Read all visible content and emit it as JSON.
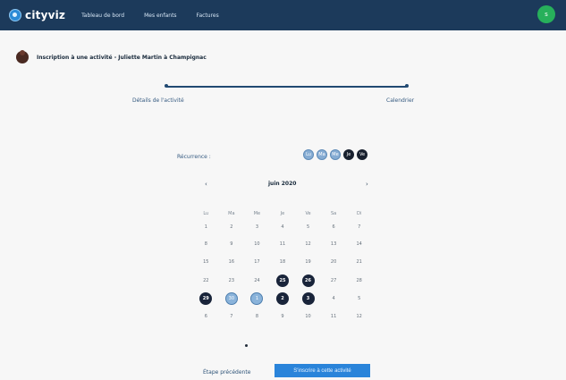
{
  "app": {
    "logo": "cityviz"
  },
  "nav": {
    "items": [
      "Tableau de bord",
      "Mes enfants",
      "Factures"
    ]
  },
  "header": {
    "title": "Inscription à une activité - Juliette Martin à Champignac",
    "avatar_text": "s"
  },
  "steps": {
    "step1": "Détails de l'activité",
    "step2": "Calendrier"
  },
  "recurrence": {
    "label": "Récurrence :",
    "chips": [
      {
        "label": "Lu",
        "style": "light"
      },
      {
        "label": "Ma",
        "style": "light"
      },
      {
        "label": "Me",
        "style": "light"
      },
      {
        "label": "Je",
        "style": "dark"
      },
      {
        "label": "Ve",
        "style": "dark"
      }
    ]
  },
  "calendar": {
    "prev": "‹",
    "next": "›",
    "month": "juin 2020",
    "weekdays": [
      "Lu",
      "Ma",
      "Me",
      "Je",
      "Ve",
      "Sa",
      "Di"
    ],
    "rows": [
      [
        {
          "t": "1"
        },
        {
          "t": "2"
        },
        {
          "t": "3"
        },
        {
          "t": "4"
        },
        {
          "t": "5"
        },
        {
          "t": "6"
        },
        {
          "t": "7"
        }
      ],
      [
        {
          "t": "8"
        },
        {
          "t": "9"
        },
        {
          "t": "10"
        },
        {
          "t": "11"
        },
        {
          "t": "12"
        },
        {
          "t": "13"
        },
        {
          "t": "14"
        }
      ],
      [
        {
          "t": "15"
        },
        {
          "t": "16"
        },
        {
          "t": "17"
        },
        {
          "t": "18"
        },
        {
          "t": "19"
        },
        {
          "t": "20"
        },
        {
          "t": "21"
        }
      ],
      [
        {
          "t": "22"
        },
        {
          "t": "23"
        },
        {
          "t": "24"
        },
        {
          "t": "25",
          "sel": "dark"
        },
        {
          "t": "26",
          "sel": "dark"
        },
        {
          "t": "27"
        },
        {
          "t": "28"
        }
      ],
      [
        {
          "t": "29",
          "sel": "dark"
        },
        {
          "t": "30",
          "sel": "light"
        },
        {
          "t": "1",
          "sel": "light"
        },
        {
          "t": "2",
          "sel": "dark"
        },
        {
          "t": "3",
          "sel": "dark"
        },
        {
          "t": "4"
        },
        {
          "t": "5"
        }
      ],
      [
        {
          "t": "6"
        },
        {
          "t": "7"
        },
        {
          "t": "8"
        },
        {
          "t": "9"
        },
        {
          "t": "10"
        },
        {
          "t": "11"
        },
        {
          "t": "12"
        }
      ]
    ]
  },
  "footer": {
    "previous": "Étape précédente",
    "submit": "S'inscrire à cette activité"
  }
}
